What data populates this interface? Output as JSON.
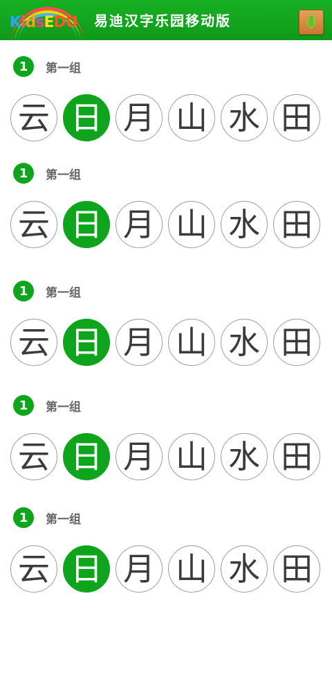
{
  "header": {
    "logo_text": "KidsEdu",
    "app_title": "易迪汉字乐园移动版",
    "download_icon": "download-arrow-icon",
    "colors": {
      "bar": "#13a51d",
      "download_btn": "#d98a44",
      "download_arrow": "#3db829"
    }
  },
  "groups": [
    {
      "number": "1",
      "title": "第一组",
      "chars": [
        "云",
        "日",
        "月",
        "山",
        "水",
        "田"
      ],
      "selected_index": 1
    },
    {
      "number": "1",
      "title": "第一组",
      "chars": [
        "云",
        "日",
        "月",
        "山",
        "水",
        "田"
      ],
      "selected_index": 1
    },
    {
      "number": "1",
      "title": "第一组",
      "chars": [
        "云",
        "日",
        "月",
        "山",
        "水",
        "田"
      ],
      "selected_index": 1
    },
    {
      "number": "1",
      "title": "第一组",
      "chars": [
        "云",
        "日",
        "月",
        "山",
        "水",
        "田"
      ],
      "selected_index": 1
    },
    {
      "number": "1",
      "title": "第一组",
      "chars": [
        "云",
        "日",
        "月",
        "山",
        "水",
        "田"
      ],
      "selected_index": 1
    }
  ],
  "colors": {
    "accent": "#0ea51c",
    "char_text": "#3b3b3b",
    "title_text": "#666666",
    "circle_border": "#9b9b9b"
  }
}
